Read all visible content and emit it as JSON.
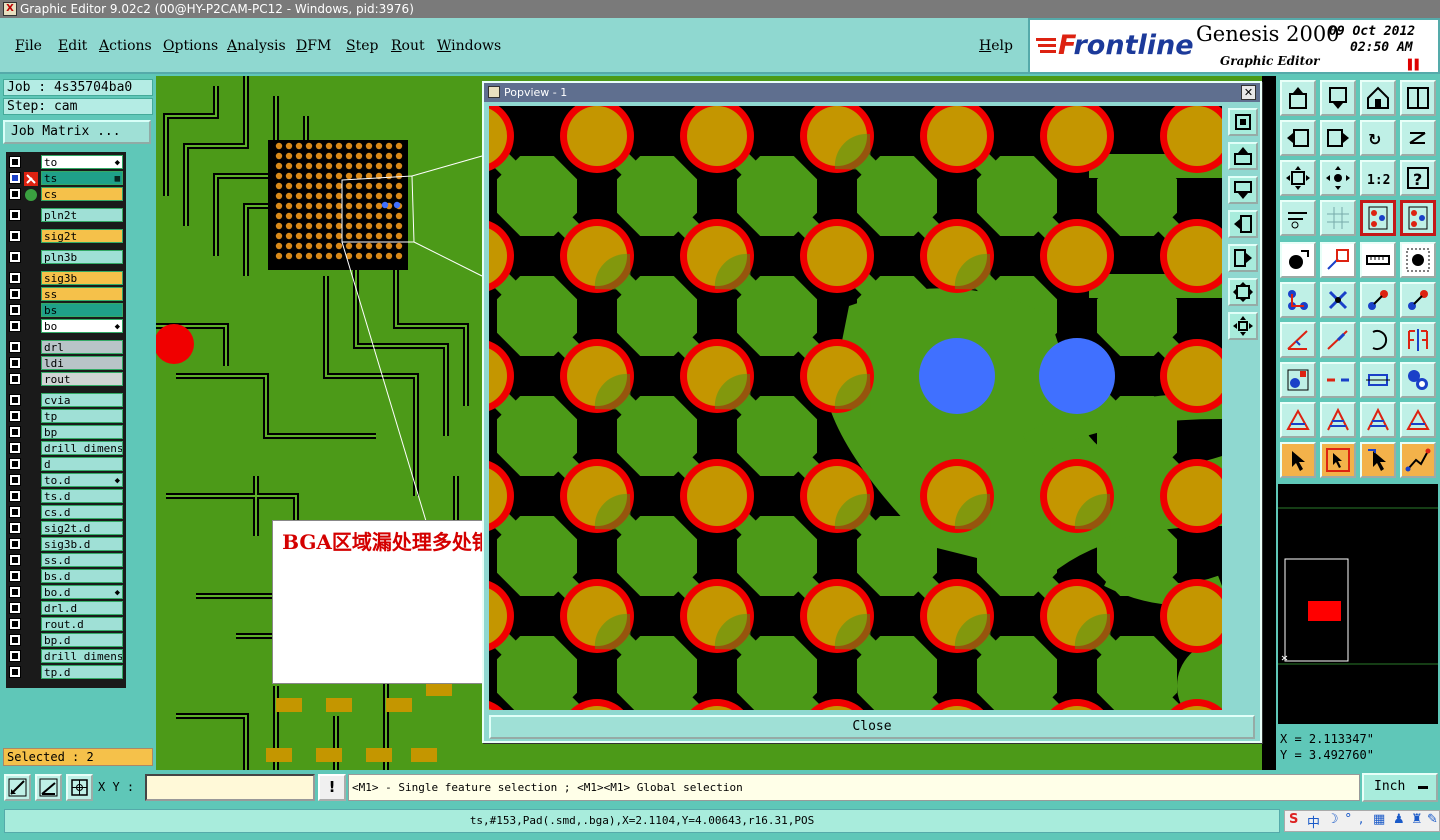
{
  "window": {
    "title": "Graphic Editor 9.02c2 (00@HY-P2CAM-PC12 - Windows, pid:3976)"
  },
  "menu": {
    "items": [
      "File",
      "Edit",
      "Actions",
      "Options",
      "Analysis",
      "DFM",
      "Step",
      "Rout",
      "Windows"
    ],
    "help": "Help"
  },
  "brand": {
    "logo_f": "F",
    "logo_rest": "rontline",
    "product": "Genesis 2000",
    "subtitle": "Graphic Editor",
    "date": "09 Oct 2012",
    "time": "02:50 AM"
  },
  "left": {
    "job": "Job : 4s35704ba0",
    "step": "Step: cam",
    "job_matrix": "Job Matrix ...",
    "selected": "Selected : 2",
    "layers": [
      {
        "name": "to",
        "color": "#ffffff",
        "flag": "◆",
        "gap": false
      },
      {
        "name": "ts",
        "color": "#1fa089",
        "flag": "▦",
        "gap": false,
        "active": true
      },
      {
        "name": "cs",
        "color": "#f5c14a",
        "flag": "",
        "gap": false
      },
      {
        "name": "pln2t",
        "color": "#9fe0d6",
        "flag": "",
        "gap": true
      },
      {
        "name": "sig2t",
        "color": "#f5c14a",
        "flag": "",
        "gap": true
      },
      {
        "name": "pln3b",
        "color": "#9fe0d6",
        "flag": "",
        "gap": true
      },
      {
        "name": "sig3b",
        "color": "#f5c14a",
        "flag": "",
        "gap": true
      },
      {
        "name": "ss",
        "color": "#f5c14a",
        "flag": "",
        "gap": false
      },
      {
        "name": "bs",
        "color": "#1fa089",
        "flag": "",
        "gap": false
      },
      {
        "name": "bo",
        "color": "#ffffff",
        "flag": "◆",
        "gap": false
      },
      {
        "name": "drl",
        "color": "#b8c4c8",
        "flag": "",
        "gap": true
      },
      {
        "name": "ldi",
        "color": "#b8c4c8",
        "flag": "",
        "gap": false
      },
      {
        "name": "rout",
        "color": "#d0d4d4",
        "flag": "",
        "gap": false
      },
      {
        "name": "cvia",
        "color": "#9fe0d6",
        "flag": "",
        "gap": true
      },
      {
        "name": "tp",
        "color": "#9fe0d6",
        "flag": "",
        "gap": false
      },
      {
        "name": "bp",
        "color": "#9fe0d6",
        "flag": "",
        "gap": false
      },
      {
        "name": "drill_dimens",
        "color": "#9fe0d6",
        "flag": "",
        "gap": false
      },
      {
        "name": "d",
        "color": "#9fe0d6",
        "flag": "",
        "gap": false
      },
      {
        "name": "to.d",
        "color": "#9fe0d6",
        "flag": "◆",
        "gap": false
      },
      {
        "name": "ts.d",
        "color": "#9fe0d6",
        "flag": "",
        "gap": false
      },
      {
        "name": "cs.d",
        "color": "#9fe0d6",
        "flag": "",
        "gap": false
      },
      {
        "name": "sig2t.d",
        "color": "#9fe0d6",
        "flag": "",
        "gap": false
      },
      {
        "name": "sig3b.d",
        "color": "#9fe0d6",
        "flag": "",
        "gap": false
      },
      {
        "name": "ss.d",
        "color": "#9fe0d6",
        "flag": "",
        "gap": false
      },
      {
        "name": "bs.d",
        "color": "#9fe0d6",
        "flag": "",
        "gap": false
      },
      {
        "name": "bo.d",
        "color": "#9fe0d6",
        "flag": "◆",
        "gap": false
      },
      {
        "name": "drl.d",
        "color": "#9fe0d6",
        "flag": "",
        "gap": false
      },
      {
        "name": "rout.d",
        "color": "#9fe0d6",
        "flag": "",
        "gap": false
      },
      {
        "name": "bp.d",
        "color": "#9fe0d6",
        "flag": "",
        "gap": false
      },
      {
        "name": "drill_dimens",
        "color": "#9fe0d6",
        "flag": "",
        "gap": false
      },
      {
        "name": "tp.d",
        "color": "#9fe0d6",
        "flag": "",
        "gap": false
      }
    ]
  },
  "popview": {
    "title": "Popview - 1",
    "close_label": "Close"
  },
  "callout": {
    "text": "BGA区域漏处理多处铜皮里开窗"
  },
  "right": {
    "x_readout": "X = 2.113347\"",
    "y_readout": "Y = 3.492760\""
  },
  "command": {
    "xy_label": "X Y :",
    "xy_value": "",
    "bang": "!",
    "hint": "<M1> - Single feature selection ; <M1><M1> Global selection",
    "units": "Inch"
  },
  "status": {
    "text": "ts,#153,Pad(.smd,.bga),X=2.1104,Y=4.00643,r16.31,POS"
  },
  "colors": {
    "copper": "#4c9a18",
    "pad": "#c49600",
    "mask_ring": "#f00000",
    "selected": "#4070ff",
    "background": "#000000",
    "panel": "#5fc7b8"
  }
}
